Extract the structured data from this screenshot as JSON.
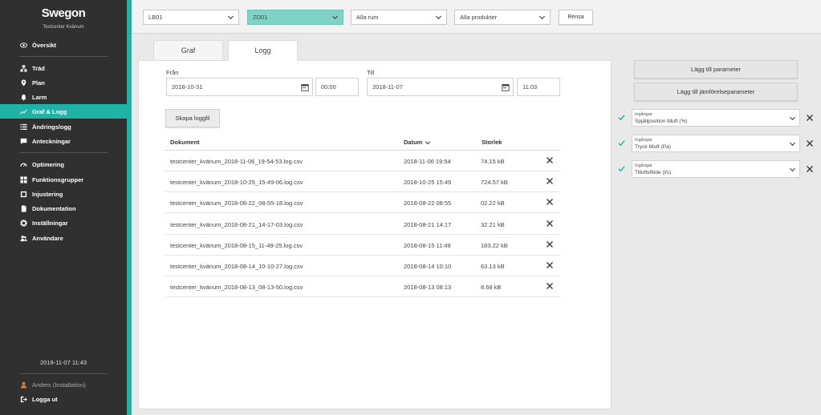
{
  "sidebar": {
    "logo": "Swegon",
    "subtitle": "Testcenter Kvänum",
    "overview": "Översikt",
    "items_a": [
      "Träd",
      "Plan",
      "Larm",
      "Graf & Logg",
      "Ändringslogg",
      "Anteckningar"
    ],
    "items_b": [
      "Optimering",
      "Funktionsgrupper",
      "Injustering",
      "Dokumentation",
      "Inställningar",
      "Användare"
    ],
    "active": "Graf & Logg",
    "datetime": "2018-11-07 11:43",
    "user": "Anders (Installation)",
    "logout": "Logga ut"
  },
  "toolbar": {
    "select1": "LB01",
    "select2": "ZD01",
    "select3": "Alla rum",
    "select4": "Alla produkter",
    "clear_label": "Rensa"
  },
  "tabs": [
    "Graf",
    "Logg"
  ],
  "active_tab": "Logg",
  "filter": {
    "from_label": "Från",
    "from_date": "2018-10-31",
    "from_time": "00:00",
    "to_label": "Till",
    "to_date": "2018-11-07",
    "to_time": "11:03"
  },
  "create_button": "Skapa loggfil",
  "table": {
    "headers": [
      "Dokument",
      "Datum",
      "Storlek"
    ],
    "rows": [
      [
        "testcenter_kvänum_2018-11-06_19-54-53.log.csv",
        "2018-11-06 19:54",
        "74.15 kB"
      ],
      [
        "testcenter_kvänum_2018-10-25_15-49-06.log.csv",
        "2018-10-25 15:49",
        "724.57 kB"
      ],
      [
        "testcenter_kvänum_2018-08-22_08-55-18.log.csv",
        "2018-08-22 08:55",
        "02.22 kB"
      ],
      [
        "testcenter_kvänum_2018-08-21_14-17-03.log.csv",
        "2018-08-21 14:17",
        "32.21 kB"
      ],
      [
        "testcenter_kvänum_2018-08-15_11-49-25.log.csv",
        "2018-08-15 11:49",
        "183.22 kB"
      ],
      [
        "testcenter_kvänum_2018-08-14_10-10-27.log.csv",
        "2018-08-14 10:10",
        "63.13 kB"
      ],
      [
        "testcenter_kvänum_2018-08-13_08-13-50.log.csv",
        "2018-08-13 08:13",
        "8.68 kB"
      ]
    ]
  },
  "right": {
    "add_param": "Lägg till parameter",
    "add_compare": "Lägg till jämförelseparameter",
    "params": [
      {
        "group": "Ingångar",
        "name": "Spjällposition tilluft (%)"
      },
      {
        "group": "Ingångar",
        "name": "Tryck tilluft (Pa)"
      },
      {
        "group": "Ingångar",
        "name": "Tilluftsflöde (l/s)"
      }
    ]
  },
  "colors": {
    "accent": "#20b2a6",
    "sidebar": "#303030"
  }
}
